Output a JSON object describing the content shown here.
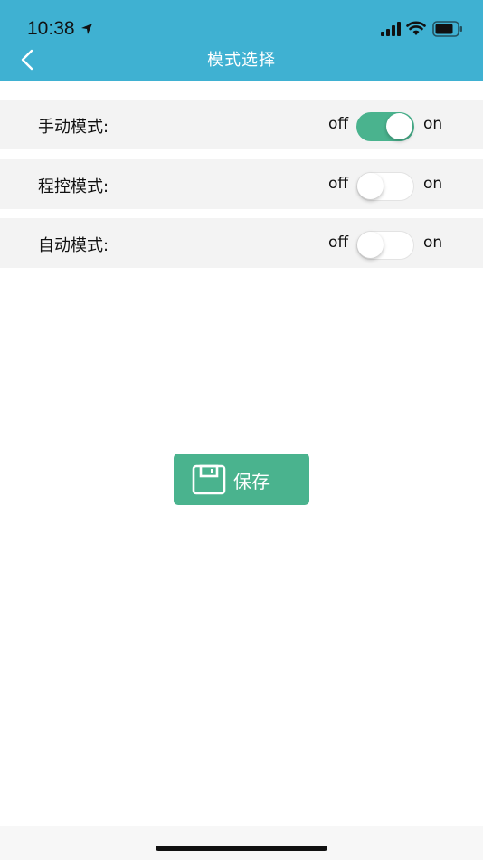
{
  "status": {
    "time": "10:38"
  },
  "nav": {
    "title": "模式选择"
  },
  "modes": [
    {
      "label": "手动模式:",
      "off_label": "off",
      "on_label": "on",
      "enabled": true
    },
    {
      "label": "程控模式:",
      "off_label": "off",
      "on_label": "on",
      "enabled": false
    },
    {
      "label": "自动模式:",
      "off_label": "off",
      "on_label": "on",
      "enabled": false
    }
  ],
  "save": {
    "label": "保存"
  },
  "colors": {
    "header": "#3fb1d2",
    "accent": "#4ab38e",
    "row_bg": "#f3f3f3"
  }
}
